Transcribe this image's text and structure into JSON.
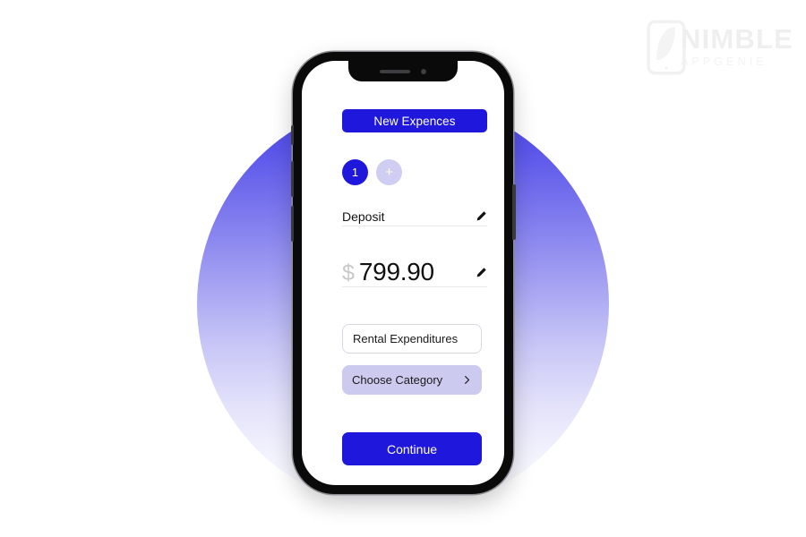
{
  "watermark": {
    "name": "NIMBLE",
    "subtitle": "APPGENIE",
    "mark_icon": "phone-n-logo-icon"
  },
  "colors": {
    "primary_blue": "#1f17dc",
    "lavender": "#cdcaef",
    "step_inactive": "#cfcdf2",
    "circle_top": "#4340e6",
    "currency_gray": "#c9c9c9",
    "frame_black": "#0a0a0a"
  },
  "device": {
    "notch_speaker": "speaker-slit-icon",
    "notch_camera": "front-camera-icon",
    "buttons": [
      "silent-switch",
      "volume-up",
      "volume-down",
      "power"
    ]
  },
  "app": {
    "header": {
      "title": "New Expences"
    },
    "steps": [
      {
        "label": "1",
        "state": "active"
      },
      {
        "label": "+",
        "state": "add"
      }
    ],
    "deposit": {
      "label": "Deposit",
      "edit_icon": "pencil-icon"
    },
    "amount": {
      "currency": "$",
      "value": "799.90",
      "edit_icon": "pencil-icon"
    },
    "note_field": {
      "value": "Rental Expenditures",
      "placeholder": "Rental Expenditures"
    },
    "category_field": {
      "label": "Choose Category",
      "chevron_icon": "chevron-right-icon"
    },
    "continue_button": {
      "label": "Continue"
    }
  }
}
